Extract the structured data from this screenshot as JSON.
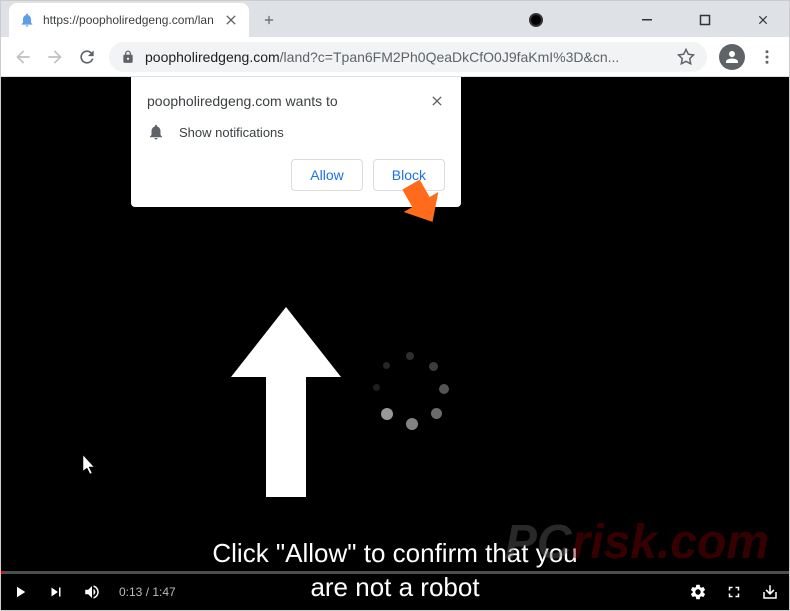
{
  "tab": {
    "title": "https://poopholiredgeng.com/lan"
  },
  "url": {
    "domain": "poopholiredgeng.com",
    "path": "/land?c=Tpan6FM2Ph0QeaDkCfO0J9faKmI%3D&cn..."
  },
  "notification": {
    "title": "poopholiredgeng.com wants to",
    "body": "Show notifications",
    "allow": "Allow",
    "block": "Block"
  },
  "page": {
    "message_line1": "Click \"Allow\" to confirm that you",
    "message_line2": "are not a robot"
  },
  "video": {
    "current_time": "0:13",
    "duration": "1:47"
  },
  "watermark": {
    "pc": "PC",
    "risk": "risk.com"
  }
}
